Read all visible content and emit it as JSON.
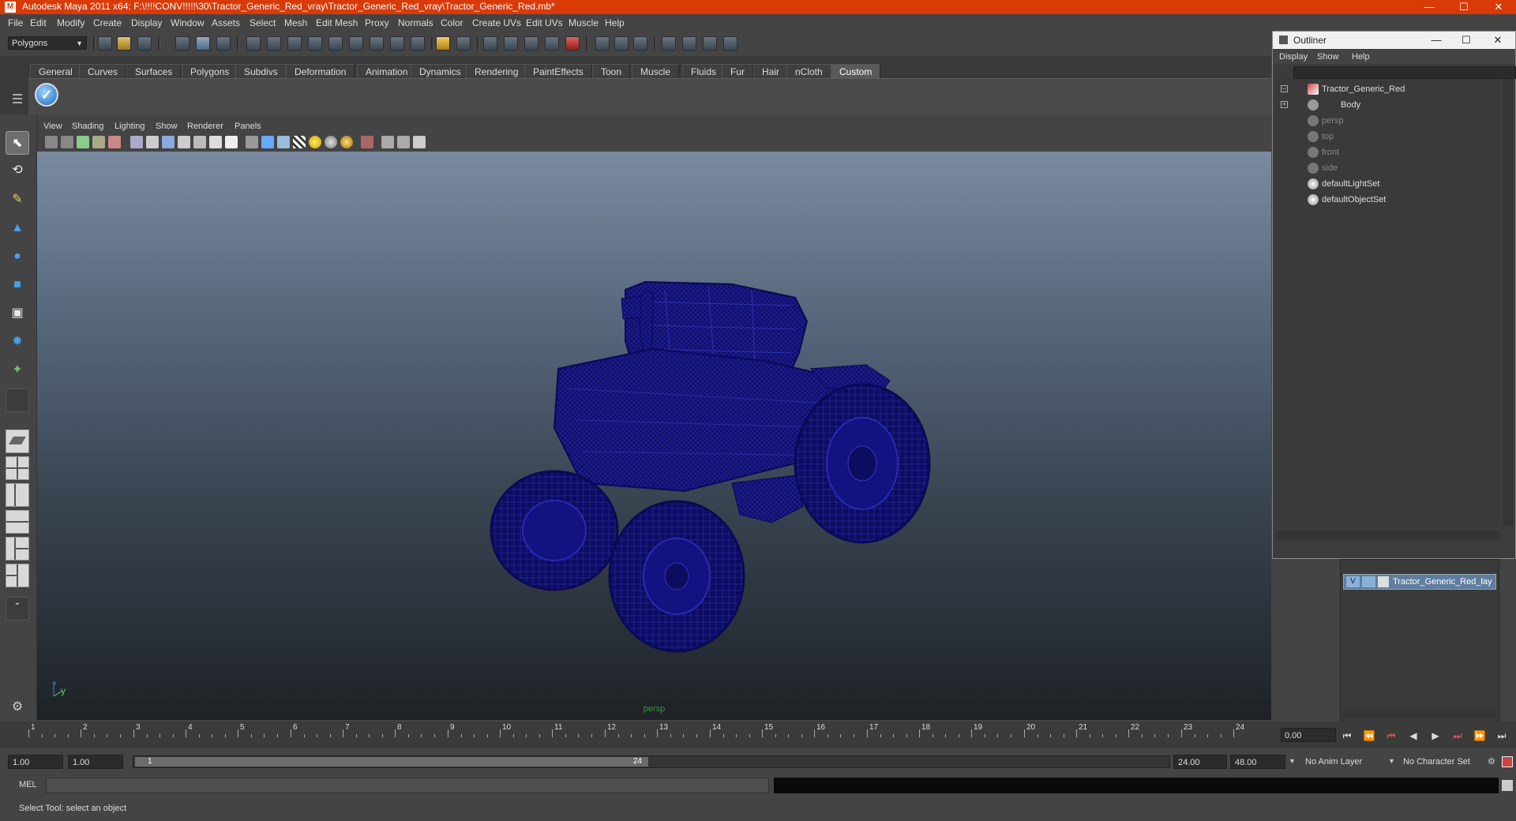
{
  "window": {
    "title": "Autodesk Maya 2011 x64: F:\\!!!!CONV!!!!!\\30\\Tractor_Generic_Red_vray\\Tractor_Generic_Red_vray\\Tractor_Generic_Red.mb*",
    "app_icon_glyph": "M"
  },
  "menubar": [
    "File",
    "Edit",
    "Modify",
    "Create",
    "Display",
    "Window",
    "Assets",
    "Select",
    "Mesh",
    "Edit Mesh",
    "Proxy",
    "Normals",
    "Color",
    "Create UVs",
    "Edit UVs",
    "Muscle",
    "Help"
  ],
  "status_line": {
    "mode": "Polygons"
  },
  "shelf": {
    "tabs": [
      "General",
      "Curves",
      "Surfaces",
      "Polygons",
      "Subdivs",
      "Deformation",
      "Animation",
      "Dynamics",
      "Rendering",
      "PaintEffects",
      "Toon",
      "Muscle",
      "Fluids",
      "Fur",
      "Hair",
      "nCloth",
      "Custom"
    ],
    "active_tab": "Custom"
  },
  "viewport": {
    "menu": [
      "View",
      "Shading",
      "Lighting",
      "Show",
      "Renderer",
      "Panels"
    ],
    "camera_label": "persp",
    "axis_y": "y",
    "axis_x": "x",
    "wire_color": "#0f0f6e"
  },
  "outliner": {
    "title": "Outliner",
    "menu": [
      "Display",
      "Show",
      "Help"
    ],
    "items": [
      {
        "label": "Tractor_Generic_Red",
        "dim": false
      },
      {
        "label": "Body",
        "dim": false
      },
      {
        "label": "persp",
        "dim": true
      },
      {
        "label": "top",
        "dim": true
      },
      {
        "label": "front",
        "dim": true
      },
      {
        "label": "side",
        "dim": true
      },
      {
        "label": "defaultLightSet",
        "dim": false
      },
      {
        "label": "defaultObjectSet",
        "dim": false
      }
    ]
  },
  "layers": {
    "visible_flag": "V",
    "items": [
      {
        "name": "Tractor_Generic_Red_lay"
      }
    ]
  },
  "timeline": {
    "ticks": [
      "1",
      "2",
      "3",
      "4",
      "5",
      "6",
      "7",
      "8",
      "9",
      "10",
      "11",
      "12",
      "13",
      "14",
      "15",
      "16",
      "17",
      "18",
      "19",
      "20",
      "21",
      "22",
      "23",
      "24"
    ],
    "current_frame": "0.00"
  },
  "range": {
    "start": "1.00",
    "playback_start": "1.00",
    "thumb_start": "1",
    "thumb_end": "24",
    "playback_end": "24.00",
    "end": "48.00",
    "anim_layer": "No Anim Layer",
    "character_set": "No Character Set"
  },
  "command": {
    "label": "MEL"
  },
  "help_line": "Select Tool: select an object"
}
